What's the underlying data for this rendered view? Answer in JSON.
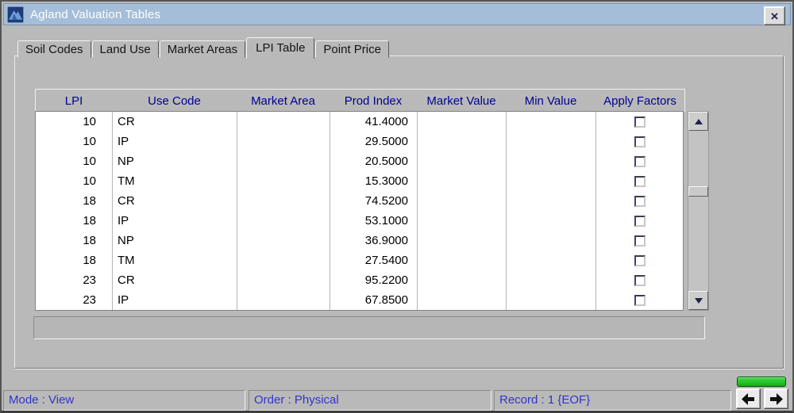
{
  "window": {
    "title": "Agland Valuation Tables",
    "close_label": "×"
  },
  "tabs": [
    {
      "label": "Soil Codes"
    },
    {
      "label": "Land Use"
    },
    {
      "label": "Market Areas"
    },
    {
      "label": "LPI Table"
    },
    {
      "label": "Point Price"
    }
  ],
  "table": {
    "columns": [
      "LPI",
      "Use Code",
      "Market Area",
      "Prod Index",
      "Market Value",
      "Min Value",
      "Apply Factors"
    ],
    "rows": [
      {
        "lpi": "10",
        "use_code": "CR",
        "market_area": "",
        "prod_index": "41.4000",
        "market_value": "",
        "min_value": "",
        "apply_factors": false
      },
      {
        "lpi": "10",
        "use_code": "IP",
        "market_area": "",
        "prod_index": "29.5000",
        "market_value": "",
        "min_value": "",
        "apply_factors": false
      },
      {
        "lpi": "10",
        "use_code": "NP",
        "market_area": "",
        "prod_index": "20.5000",
        "market_value": "",
        "min_value": "",
        "apply_factors": false
      },
      {
        "lpi": "10",
        "use_code": "TM",
        "market_area": "",
        "prod_index": "15.3000",
        "market_value": "",
        "min_value": "",
        "apply_factors": false
      },
      {
        "lpi": "18",
        "use_code": "CR",
        "market_area": "",
        "prod_index": "74.5200",
        "market_value": "",
        "min_value": "",
        "apply_factors": false
      },
      {
        "lpi": "18",
        "use_code": "IP",
        "market_area": "",
        "prod_index": "53.1000",
        "market_value": "",
        "min_value": "",
        "apply_factors": false
      },
      {
        "lpi": "18",
        "use_code": "NP",
        "market_area": "",
        "prod_index": "36.9000",
        "market_value": "",
        "min_value": "",
        "apply_factors": false
      },
      {
        "lpi": "18",
        "use_code": "TM",
        "market_area": "",
        "prod_index": "27.5400",
        "market_value": "",
        "min_value": "",
        "apply_factors": false
      },
      {
        "lpi": "23",
        "use_code": "CR",
        "market_area": "",
        "prod_index": "95.2200",
        "market_value": "",
        "min_value": "",
        "apply_factors": false
      },
      {
        "lpi": "23",
        "use_code": "IP",
        "market_area": "",
        "prod_index": "67.8500",
        "market_value": "",
        "min_value": "",
        "apply_factors": false
      }
    ]
  },
  "status": {
    "mode": "Mode : View",
    "order": "Order : Physical",
    "record": "Record : 1 {EOF}"
  },
  "colors": {
    "titlebar": "#a4bed9",
    "header_text": "#000096",
    "status_text": "#3333cc",
    "green_indicator": "#12ae14"
  }
}
